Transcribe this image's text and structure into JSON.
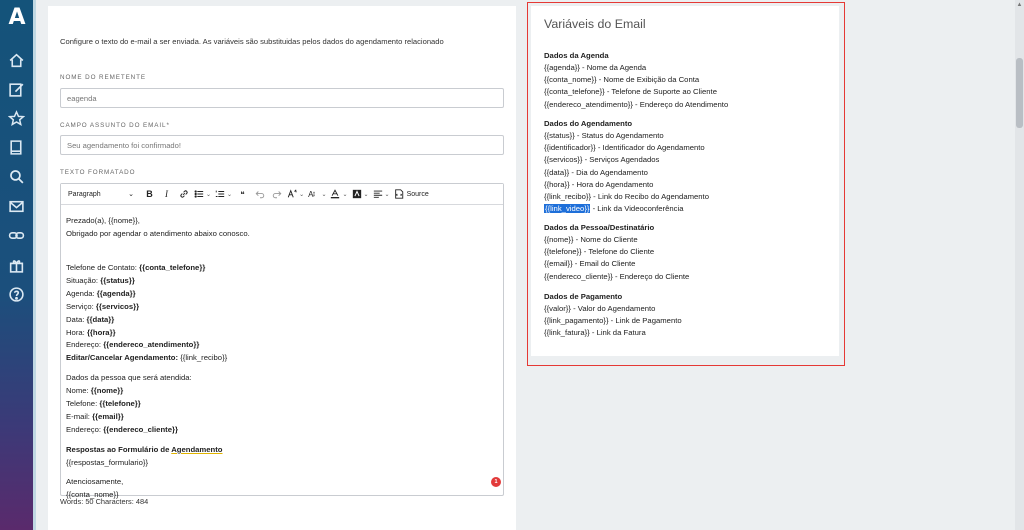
{
  "brand": {
    "logo_letter": "A"
  },
  "nav": {
    "icons": [
      "home-icon",
      "edit-icon",
      "star-icon",
      "book-icon",
      "search-icon",
      "mail-icon",
      "link-icon",
      "gift-icon",
      "help-icon"
    ]
  },
  "editor": {
    "intro": "Configure o texto do e-mail a ser enviada. As variáveis são substituidas pelos dados do agendamento relacionado",
    "sender_label": "NOME DO REMETENTE",
    "sender_value": "eagenda",
    "subject_label": "CAMPO ASSUNTO DO EMAIL*",
    "subject_value": "Seu agendamento foi confirmado!",
    "body_label": "TEXTO FORMATADO",
    "toolbar": {
      "paragraph": "Paragraph",
      "bold": "B",
      "italic": "I",
      "quote": "❝",
      "font_size": "A",
      "source": "Source"
    },
    "content": {
      "l1": "Prezado(a), {{nome}},",
      "l2": "Obrigado por agendar o atendimento abaixo conosco.",
      "l3a": "Telefone de Contato: ",
      "l3b": "{{conta_telefone}}",
      "l4a": "Situação: ",
      "l4b": "{{status}}",
      "l5a": "Agenda: ",
      "l5b": "{{agenda}}",
      "l6a": "Serviço: ",
      "l6b": "{{servicos}}",
      "l7a": "Data: ",
      "l7b": "{{data}}",
      "l8a": "Hora: ",
      "l8b": "{{hora}}",
      "l9a": "Endereço: ",
      "l9b": "{{endereco_atendimento}}",
      "l10a": "Editar/Cancelar Agendamento:",
      "l10b": " {{link_recibo}}",
      "l11": "Dados da pessoa que será atendida:",
      "l12a": "Nome: ",
      "l12b": "{{nome}}",
      "l13a": "Telefone: ",
      "l13b": "{{telefone}}",
      "l14a": "E-mail: ",
      "l14b": "{{email}}",
      "l15a": "Endereço: ",
      "l15b": "{{endereco_cliente}}",
      "l16a": "Respostas ao Formulário de ",
      "l16b": "Agendamento",
      "l17": "{{respostas_formulario}}",
      "l18": "Atenciosamente,",
      "l19": "{{conta_nome}}"
    },
    "badge": "1",
    "word_count": "Words: 50  Characters: 484"
  },
  "variables": {
    "title": "Variáveis do Email",
    "groups": [
      {
        "title": "Dados da Agenda",
        "lines": [
          "{{agenda}} - Nome da Agenda",
          "{{conta_nome}} - Nome de Exibição da Conta",
          "{{conta_telefone}} - Telefone de Suporte ao Cliente",
          "{{endereco_atendimento}} - Endereço do Atendimento"
        ]
      },
      {
        "title": "Dados do Agendamento",
        "lines": [
          "{{status}} - Status do Agendamento",
          "{{identificador}} - Identificador do Agendamento",
          "{{servicos}} - Serviços Agendados",
          "{{data}} - Dia do Agendamento",
          "{{hora}} - Hora do Agendamento",
          "{{link_recibo}} - Link do Recibo do Agendamento"
        ],
        "highlight_var": "{{link_video}}",
        "highlight_desc": " - Link da Videoconferência"
      },
      {
        "title": "Dados da Pessoa/Destinatário",
        "lines": [
          "{{nome}} - Nome do Cliente",
          "{{telefone}} - Telefone do Cliente",
          "{{email}} - Email do Cliente",
          "{{endereco_cliente}} - Endereço do Cliente"
        ]
      },
      {
        "title": "Dados de Pagamento",
        "lines": [
          "{{valor}} - Valor do Agendamento",
          "{{link_pagamento}} - Link de Pagamento",
          "{{link_fatura}} - Link da Fatura"
        ]
      }
    ]
  }
}
